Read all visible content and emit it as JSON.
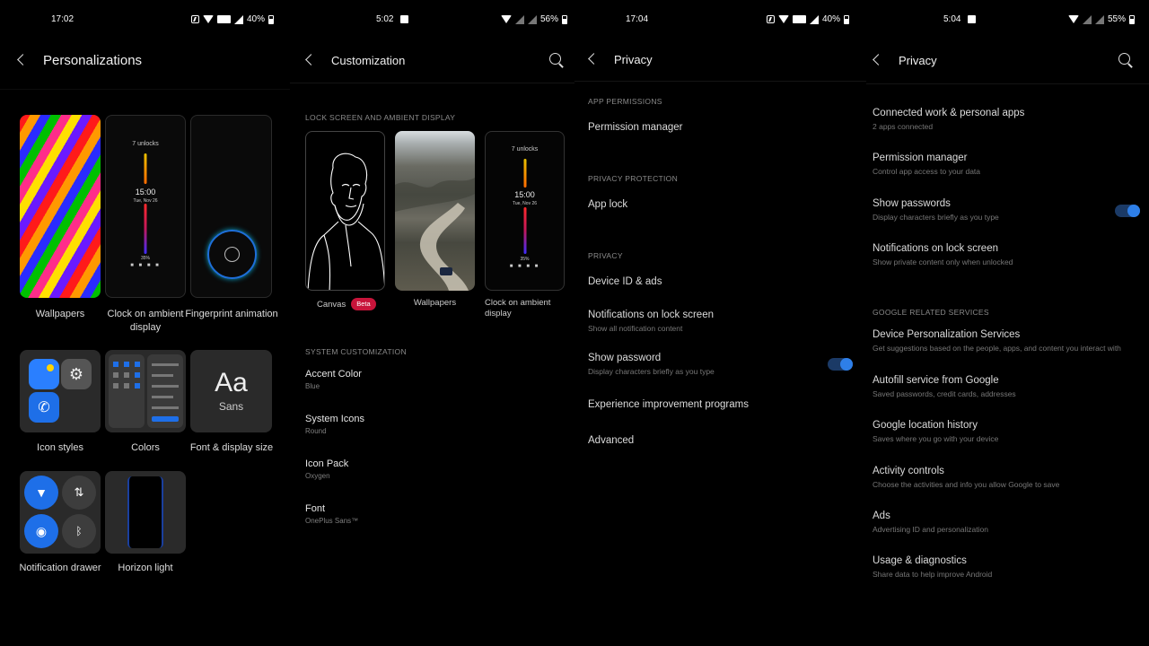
{
  "panel1": {
    "status": {
      "time": "17:02",
      "battery": "40%"
    },
    "title": "Personalizations",
    "aod_preview": {
      "unlocks_count": "7",
      "unlocks_label": "unlocks",
      "time": "15:00",
      "date": "Tue, Nov 26",
      "battery": "35%"
    },
    "tiles": [
      {
        "label": "Wallpapers"
      },
      {
        "label": "Clock on ambient display"
      },
      {
        "label": "Fingerprint animation"
      },
      {
        "label": "Icon styles"
      },
      {
        "label": "Colors"
      },
      {
        "label": "Font & display size",
        "preview_big": "Aa",
        "preview_small": "Sans"
      },
      {
        "label": "Notification drawer"
      },
      {
        "label": "Horizon light"
      }
    ]
  },
  "panel2": {
    "status": {
      "time": "5:02",
      "battery": "56%"
    },
    "title": "Customization",
    "section_lock": "LOCK SCREEN AND AMBIENT DISPLAY",
    "cards": [
      {
        "label": "Canvas",
        "badge": "Beta"
      },
      {
        "label": "Wallpapers"
      },
      {
        "label": "Clock on ambient display"
      }
    ],
    "aod_preview": {
      "unlocks_count": "7",
      "unlocks_label": "unlocks",
      "time": "15:00",
      "date": "Tue, Nov 26",
      "battery": "35%"
    },
    "section_system": "SYSTEM CUSTOMIZATION",
    "items": [
      {
        "title": "Accent Color",
        "sub": "Blue"
      },
      {
        "title": "System Icons",
        "sub": "Round"
      },
      {
        "title": "Icon Pack",
        "sub": "Oxygen"
      },
      {
        "title": "Font",
        "sub": "OnePlus Sans™"
      }
    ]
  },
  "panel3": {
    "status": {
      "time": "17:04",
      "battery": "40%"
    },
    "title": "Privacy",
    "sections": {
      "app_permissions": "APP PERMISSIONS",
      "privacy_protection": "PRIVACY PROTECTION",
      "privacy": "PRIVACY"
    },
    "rows": {
      "permission_manager": "Permission manager",
      "app_lock": "App lock",
      "device_id": "Device ID & ads",
      "notif_title": "Notifications on lock screen",
      "notif_sub": "Show all notification content",
      "show_pw_title": "Show password",
      "show_pw_sub": "Display characters briefly as you type",
      "experience": "Experience improvement programs",
      "advanced": "Advanced"
    }
  },
  "panel4": {
    "status": {
      "time": "5:04",
      "battery": "55%"
    },
    "title": "Privacy",
    "rows": [
      {
        "title": "Connected work & personal apps",
        "sub": "2 apps connected"
      },
      {
        "title": "Permission manager",
        "sub": "Control app access to your data"
      },
      {
        "title": "Show passwords",
        "sub": "Display characters briefly as you type"
      },
      {
        "title": "Notifications on lock screen",
        "sub": "Show private content only when unlocked"
      }
    ],
    "section_google": "GOOGLE RELATED SERVICES",
    "google_rows": [
      {
        "title": "Device Personalization Services",
        "sub": "Get suggestions based on the people, apps, and content you interact with"
      },
      {
        "title": "Autofill service from Google",
        "sub": "Saved passwords, credit cards, addresses"
      },
      {
        "title": "Google location history",
        "sub": "Saves where you go with your device"
      },
      {
        "title": "Activity controls",
        "sub": "Choose the activities and info you allow Google to save"
      },
      {
        "title": "Ads",
        "sub": "Advertising ID and personalization"
      },
      {
        "title": "Usage & diagnostics",
        "sub": "Share data to help improve Android"
      }
    ]
  },
  "colors": {
    "accent": "#2e7fe8",
    "beta": "#c8143a",
    "background": "#000000"
  }
}
